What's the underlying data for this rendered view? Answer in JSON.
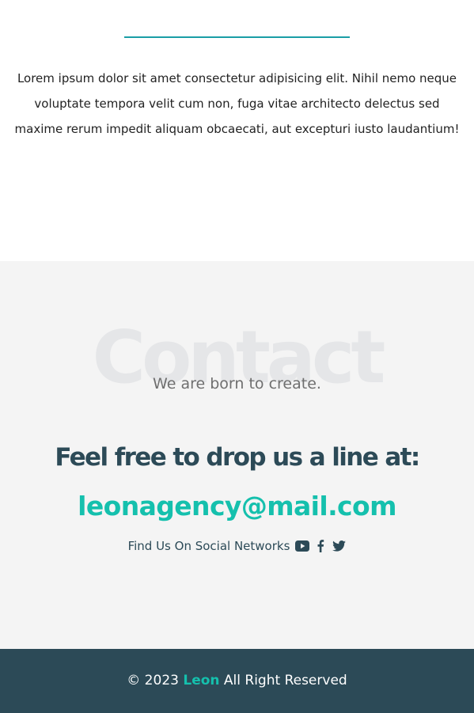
{
  "about": {
    "text": "Lorem ipsum dolor sit amet consectetur adipisicing elit. Nihil nemo neque voluptate tempora velit cum non, fuga vitae architecto delectus sed maxime rerum impedit aliquam obcaecati, aut excepturi iusto laudantium!"
  },
  "contact": {
    "background_word": "Contact",
    "tagline": "We are born to create.",
    "headline": "Feel free to drop us a line at:",
    "email": "leonagency@mail.com",
    "social_label": "Find Us On Social Networks",
    "social_icons": [
      "youtube-icon",
      "facebook-icon",
      "twitter-icon"
    ]
  },
  "footer": {
    "copyright": "© 2023",
    "brand": "Leon",
    "rights": "All Right Reserved"
  },
  "colors": {
    "accent": "#15c0ad",
    "dark": "#2c4a57",
    "divider": "#1a9ea6",
    "section_bg": "#f4f4f4"
  }
}
